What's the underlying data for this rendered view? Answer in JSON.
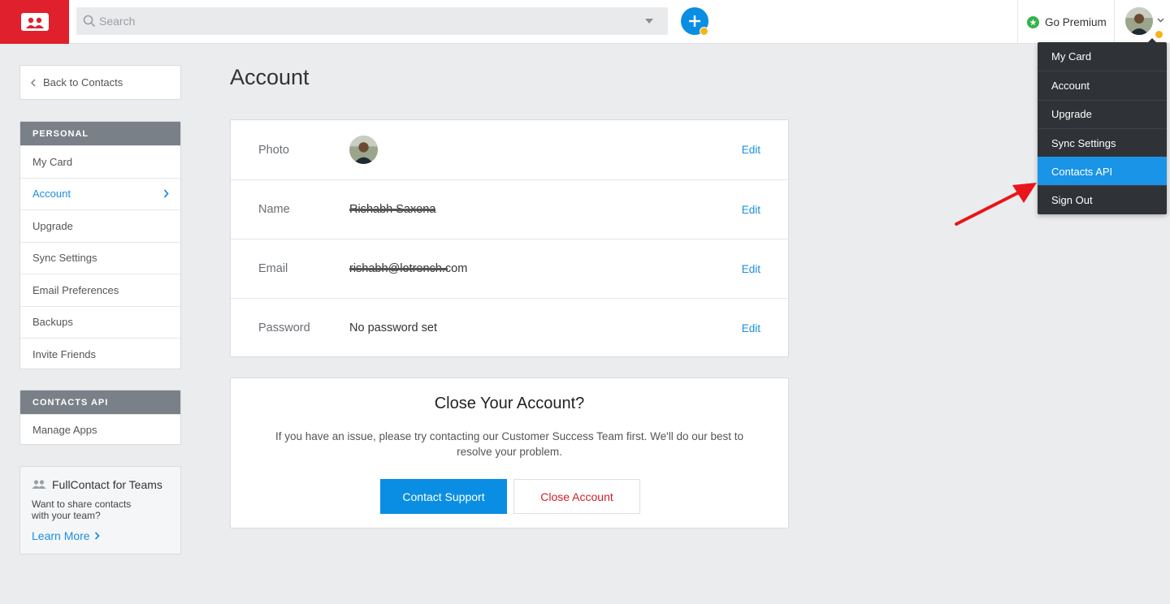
{
  "topbar": {
    "search_placeholder": "Search",
    "premium_label": "Go Premium",
    "brand_color": "#e0202c",
    "accent_color": "#0a8ee3"
  },
  "sidebar": {
    "back_label": "Back to Contacts",
    "personal_heading": "PERSONAL",
    "personal_items": [
      "My Card",
      "Account",
      "Upgrade",
      "Sync Settings",
      "Email Preferences",
      "Backups",
      "Invite Friends"
    ],
    "active_item": "Account",
    "api_heading": "CONTACTS API",
    "api_items": [
      "Manage Apps"
    ],
    "teams": {
      "title": "FullContact for Teams",
      "description": "Want to share contacts with your team?",
      "link": "Learn More"
    }
  },
  "main": {
    "title": "Account",
    "rows": [
      {
        "label": "Photo",
        "value": "",
        "edit": "Edit"
      },
      {
        "label": "Name",
        "value": "Rishabh Saxena",
        "edit": "Edit"
      },
      {
        "label": "Email",
        "value": "rishabh@lotrench.com",
        "edit": "Edit"
      },
      {
        "label": "Password",
        "value": "No password set",
        "edit": "Edit"
      }
    ],
    "close_account": {
      "title": "Close Your Account?",
      "description": "If you have an issue, please try contacting our Customer Success Team first. We'll do our best to resolve your problem.",
      "primary_button": "Contact Support",
      "danger_button": "Close Account"
    }
  },
  "dropdown": {
    "items": [
      "My Card",
      "Account",
      "Upgrade",
      "Sync Settings",
      "Contacts API",
      "Sign Out"
    ],
    "highlighted": "Contacts API"
  }
}
